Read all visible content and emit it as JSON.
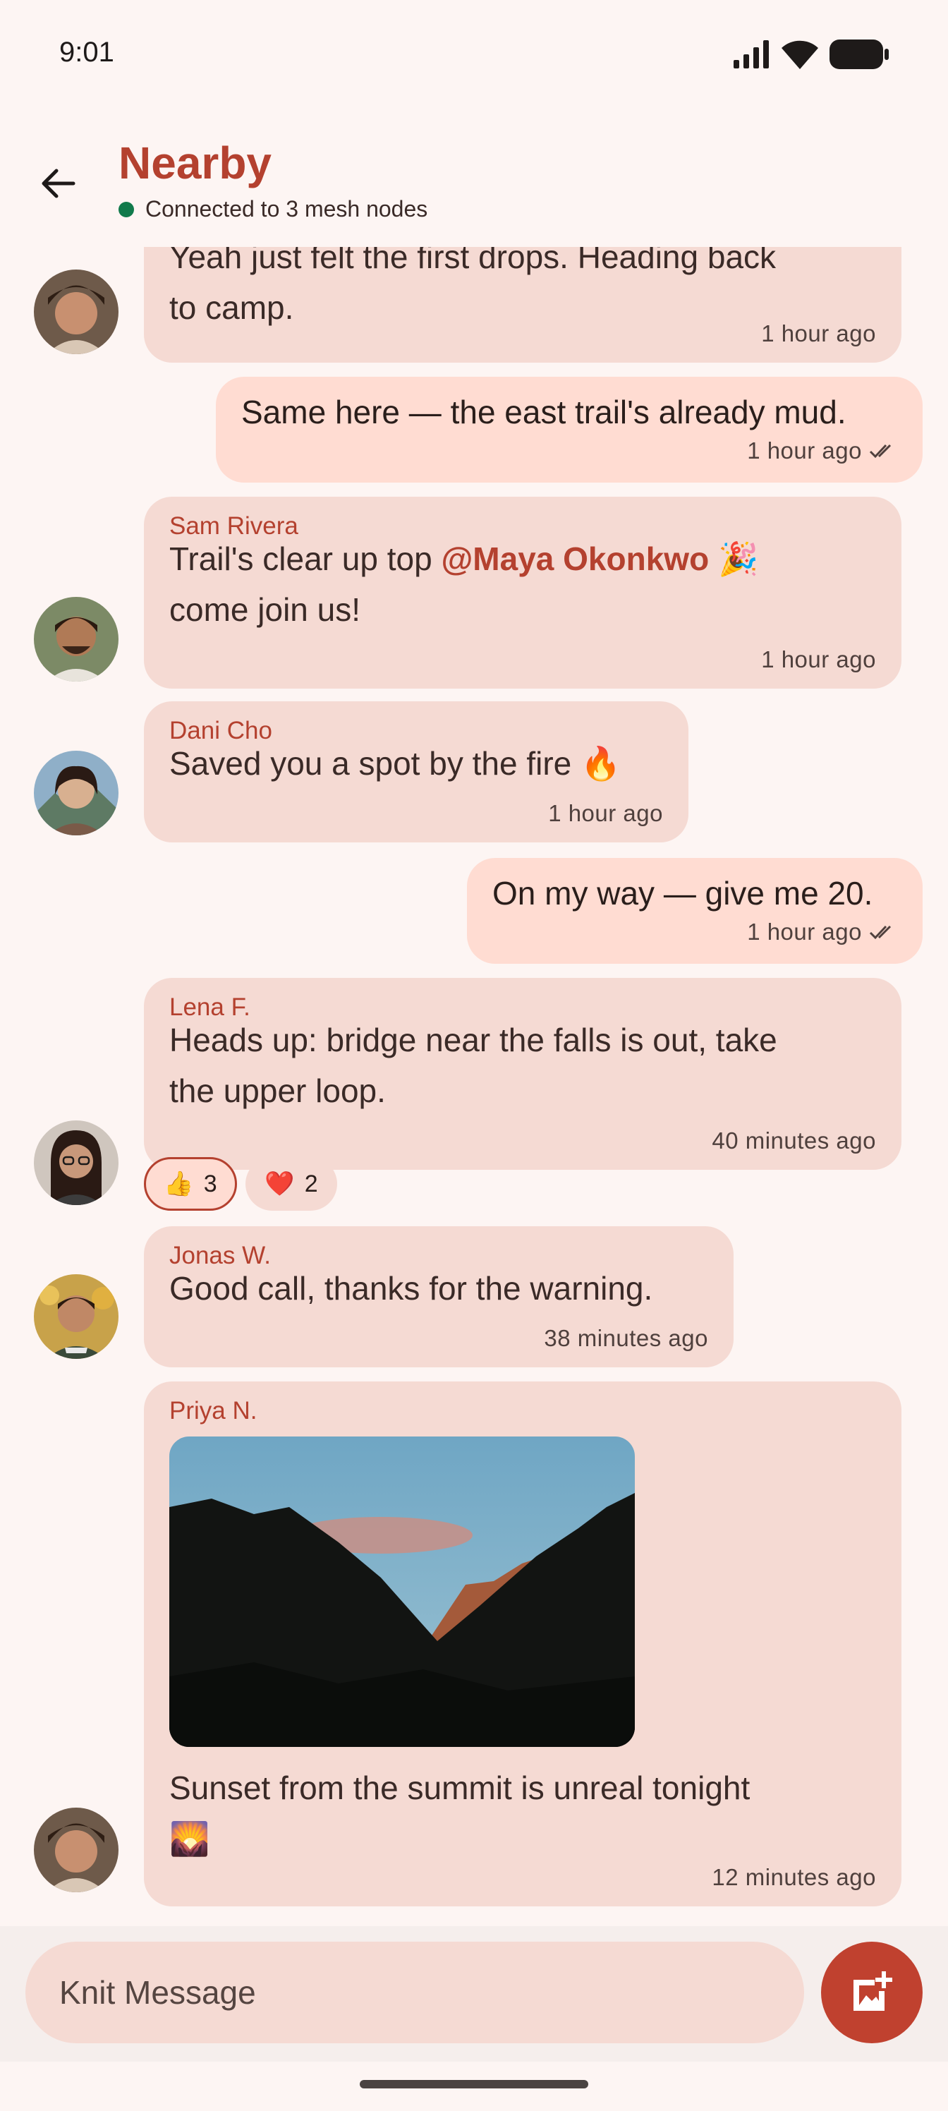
{
  "status_bar": {
    "time": "9:01"
  },
  "header": {
    "title": "Nearby",
    "subtitle": "Connected to 3 mesh nodes",
    "online_color": "#117A4B",
    "accent_color": "#B4412F"
  },
  "messages": [
    {
      "sender": "",
      "text_line1": "Yeah just felt the first drops. Heading back",
      "text_line2": "to camp.",
      "time": "1 hour ago",
      "outgoing": false
    },
    {
      "sender": "",
      "text": "Same here — the east trail's already mud.",
      "time": "1 hour ago",
      "outgoing": true,
      "status_icon": "double-check-icon"
    },
    {
      "sender": "Sam Rivera",
      "text_prefix": "Trail's clear up top ",
      "mention": "@Maya Okonkwo",
      "emoji": "🎉",
      "text_line2": "come join us!",
      "time": "1 hour ago",
      "outgoing": false
    },
    {
      "sender": "Dani Cho",
      "text": "Saved you a spot by the fire 🔥",
      "time": "1 hour ago",
      "outgoing": false
    },
    {
      "sender": "",
      "text": "On my way — give me 20.",
      "time": "1 hour ago",
      "outgoing": true,
      "status_icon": "double-check-icon"
    },
    {
      "sender": "Lena F.",
      "text_line1": "Heads up: bridge near the falls is out, take",
      "text_line2": "the upper loop.",
      "time": "40 minutes ago",
      "outgoing": false,
      "reactions": [
        {
          "emoji": "👍",
          "count": "3",
          "selected": true
        },
        {
          "emoji": "❤️",
          "count": "2",
          "selected": false
        }
      ]
    },
    {
      "sender": "Jonas W.",
      "text": "Good call, thanks for the warning.",
      "time": "38 minutes ago",
      "outgoing": false
    },
    {
      "sender": "Priya N.",
      "text_line1": "Sunset from the summit is unreal tonight",
      "text_line2": "🌄",
      "time": "12 minutes ago",
      "outgoing": false,
      "image": "mountain-sunset-photo"
    }
  ],
  "composer": {
    "placeholder": "Knit Message",
    "attach_icon": "add-photo-icon"
  }
}
